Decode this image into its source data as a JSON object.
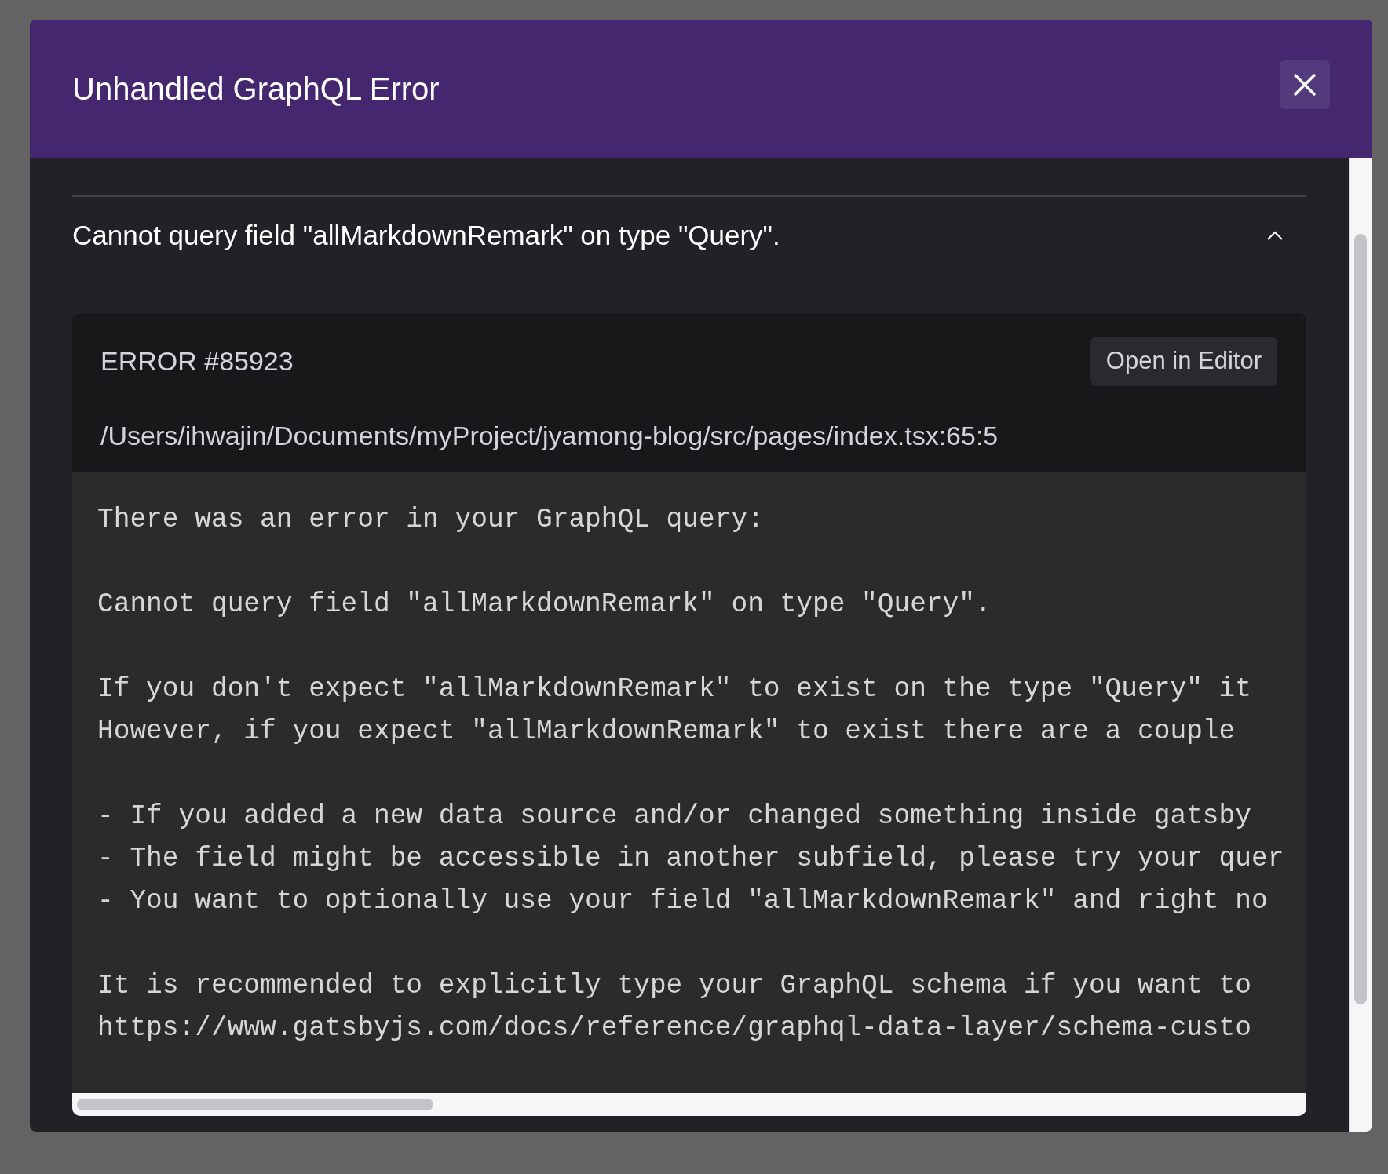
{
  "dialog": {
    "title": "Unhandled GraphQL Error"
  },
  "accordion": {
    "title": "Cannot query field \"allMarkdownRemark\" on type \"Query\".",
    "expanded": true
  },
  "error": {
    "code": "ERROR #85923",
    "open_button": "Open in Editor",
    "file_path": "/Users/ihwajin/Documents/myProject/jyamong-blog/src/pages/index.tsx:65:5",
    "paragraphs": [
      [
        "There was an error in your GraphQL query:"
      ],
      [
        "Cannot query field \"allMarkdownRemark\" on type \"Query\"."
      ],
      [
        "If you don't expect \"allMarkdownRemark\" to exist on the type \"Query\" it",
        "However, if you expect \"allMarkdownRemark\" to exist there are a couple"
      ],
      [
        "- If you added a new data source and/or changed something inside gatsby",
        "- The field might be accessible in another subfield, please try your quer",
        "- You want to optionally use your field \"allMarkdownRemark\" and right no"
      ],
      [
        "It is recommended to explicitly type your GraphQL schema if you want to",
        "https://www.gatsbyjs.com/docs/reference/graphql-data-layer/schema-custo"
      ]
    ]
  }
}
